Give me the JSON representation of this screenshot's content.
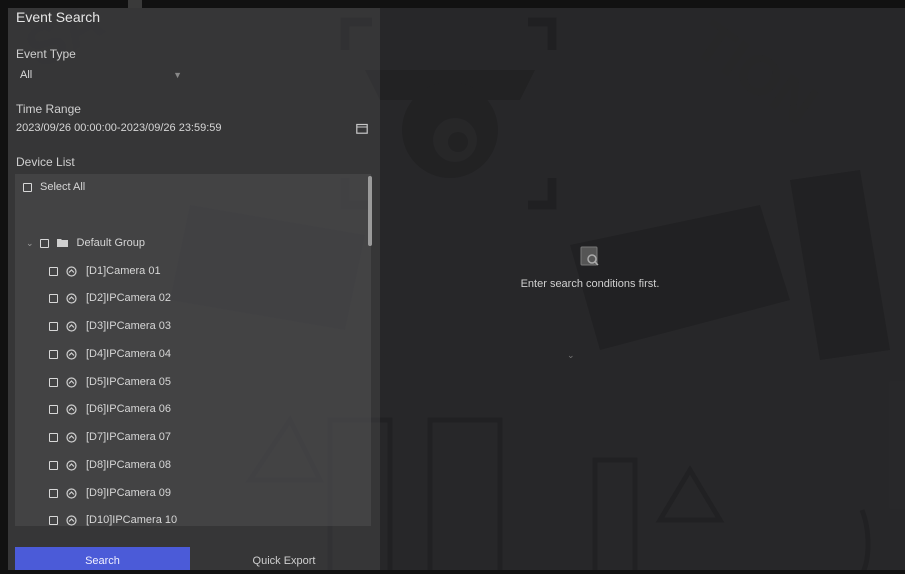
{
  "page": {
    "title": "Event Search"
  },
  "event_type": {
    "label": "Event Type",
    "value": "All"
  },
  "time_range": {
    "label": "Time Range",
    "value": "2023/09/26 00:00:00-2023/09/26 23:59:59"
  },
  "device_list": {
    "label": "Device List",
    "select_all": "Select All",
    "group_name": "Default Group",
    "cameras": [
      "[D1]Camera 01",
      "[D2]IPCamera 02",
      "[D3]IPCamera 03",
      "[D4]IPCamera 04",
      "[D5]IPCamera 05",
      "[D6]IPCamera 06",
      "[D7]IPCamera 07",
      "[D8]IPCamera 08",
      "[D9]IPCamera 09",
      "[D10]IPCamera 10"
    ]
  },
  "actions": {
    "search": "Search",
    "quick_export": "Quick Export"
  },
  "result": {
    "empty_message": "Enter search conditions first."
  },
  "colors": {
    "accent": "#4b5bd8",
    "left_panel": "#3a3a3c",
    "background": "#2c2c2e"
  },
  "icons": [
    "calendar-icon",
    "folder-icon",
    "camera-icon",
    "chevron-down-icon",
    "empty-result-icon"
  ]
}
